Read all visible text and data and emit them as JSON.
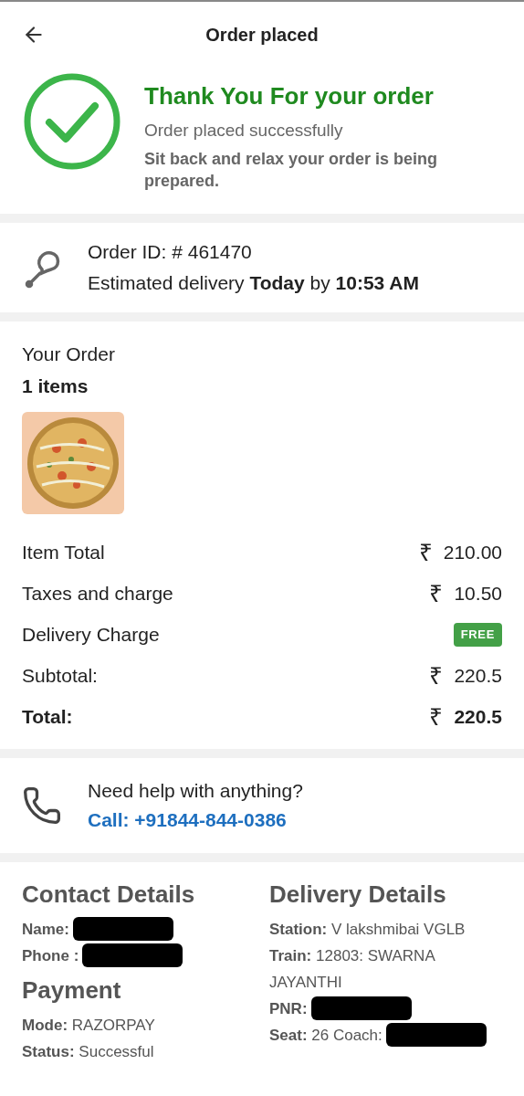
{
  "header": {
    "title": "Order placed"
  },
  "success": {
    "title": "Thank You For your order",
    "subtitle": "Order placed successfully",
    "message": "Sit back and relax your order is being prepared."
  },
  "order_info": {
    "order_id": "Order ID: # 461470",
    "delivery": "Estimated delivery **Today** by **10:53 AM**"
  },
  "your_order": {
    "title": "Your Order",
    "count": "1 items"
  },
  "bill": [
    {
      "kind": "amount",
      "label": "Item Total",
      "currency": "₹",
      "value": "210.00"
    },
    {
      "kind": "amount",
      "label": "Taxes and charge",
      "currency": "₹",
      "value": "10.50"
    },
    {
      "kind": "badge",
      "label": "Delivery Charge",
      "value": "FREE"
    },
    {
      "kind": "amount",
      "label": "Subtotal:",
      "currency": "₹",
      "value": "220.5"
    },
    {
      "kind": "total",
      "label": "Total:",
      "currency": "₹",
      "value": "220.5"
    }
  ],
  "help": {
    "question": "Need help with anything?",
    "call": "Call: +91844-844-0386"
  },
  "contact": {
    "title": "Contact Details",
    "rows": [
      {
        "label": "Name:",
        "redacted": true
      },
      {
        "label": "Phone :",
        "redacted": true
      }
    ]
  },
  "payment": {
    "title": "Payment",
    "rows": [
      {
        "label": "Mode:",
        "value": "RAZORPAY",
        "redacted": false
      },
      {
        "label": "Status:",
        "value": "Successful",
        "redacted": false
      }
    ]
  },
  "delivery": {
    "title": "Delivery Details",
    "rows": [
      {
        "label": "Station:",
        "value": "V lakshmibai VGLB",
        "redacted": false
      },
      {
        "label": "Train:",
        "value": "12803: SWARNA JAYANTHI",
        "redacted": false
      },
      {
        "label": "PNR:",
        "redacted": true
      },
      {
        "label": "Seat:",
        "value": "26 Coach:",
        "redacted": true
      }
    ]
  }
}
